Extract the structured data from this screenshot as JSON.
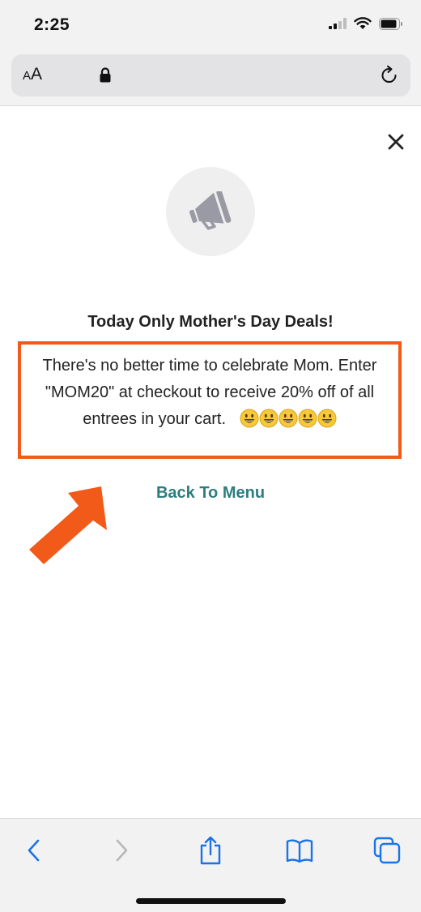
{
  "status_bar": {
    "time": "2:25"
  },
  "browser": {
    "text_size_label_small": "A",
    "text_size_label_large": "A"
  },
  "promo": {
    "title": "Today Only Mother's Day Deals!",
    "message": "There's no better time to celebrate Mom. Enter \"MOM20\" at checkout to receive 20% off of all entrees in your cart.",
    "emoji_count": 5,
    "back_link": "Back To Menu"
  },
  "colors": {
    "highlight_border": "#f25a1a",
    "arrow": "#f25a1a",
    "link": "#2d7d7f",
    "ios_blue": "#1a73e8"
  },
  "icons": {
    "close": "close-icon",
    "megaphone": "megaphone-icon",
    "toolbar": [
      "back-icon",
      "forward-icon",
      "share-icon",
      "bookmarks-icon",
      "tabs-icon"
    ]
  }
}
